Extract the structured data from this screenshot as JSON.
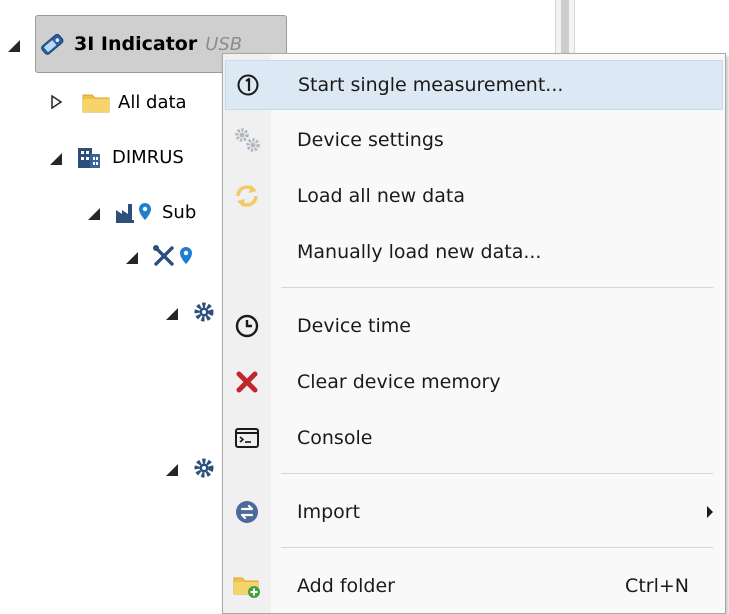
{
  "tree": {
    "root": {
      "label": "3I Indicator",
      "connection": "USB"
    },
    "items": [
      {
        "label": "All data"
      },
      {
        "label": "DIMRUS"
      },
      {
        "label": "Sub"
      }
    ]
  },
  "context_menu": {
    "items": [
      {
        "label": "Start single measurement...",
        "icon": "number-one-circle-icon"
      },
      {
        "label": "Device settings",
        "icon": "gears-icon"
      },
      {
        "label": "Load all new data",
        "icon": "refresh-icon"
      },
      {
        "label": "Manually load new data...",
        "icon": ""
      },
      {
        "label": "Device time",
        "icon": "clock-icon"
      },
      {
        "label": "Clear device memory",
        "icon": "red-x-icon"
      },
      {
        "label": "Console",
        "icon": "console-icon"
      },
      {
        "label": "Import",
        "icon": "import-icon"
      },
      {
        "label": "Add folder",
        "icon": "add-folder-icon",
        "shortcut": "Ctrl+N"
      }
    ]
  },
  "colors": {
    "highlight": "#dde8f5",
    "accent_blue": "#1e7fd1",
    "danger_red": "#c0262d",
    "folder_yellow": "#f0c24b",
    "add_green": "#43a33b"
  }
}
